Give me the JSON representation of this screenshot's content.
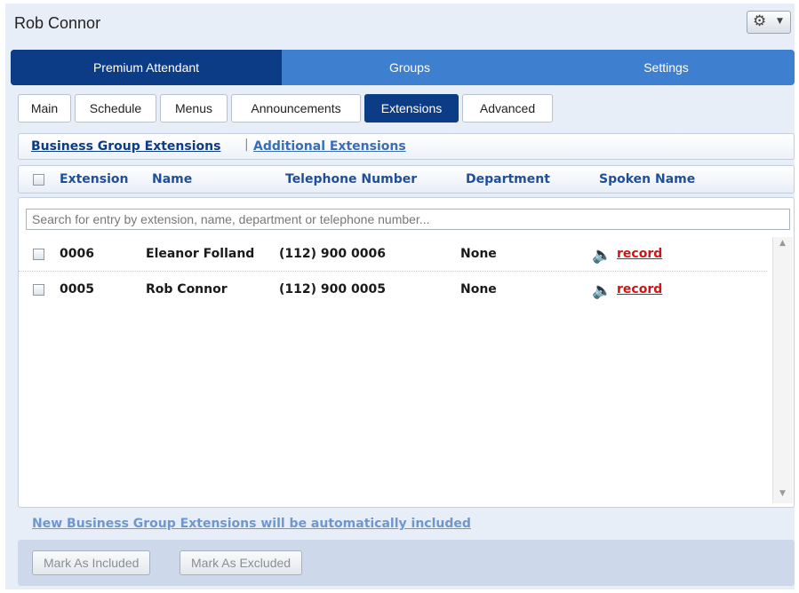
{
  "window": {
    "title": "Rob Connor",
    "gear_icon": "gear-icon",
    "caret_icon": "chevron-down-icon"
  },
  "main_tabs": [
    {
      "label": "Premium Attendant",
      "active": true
    },
    {
      "label": "Groups",
      "active": false
    },
    {
      "label": "Settings",
      "active": false
    }
  ],
  "sub_tabs": [
    {
      "label": "Main"
    },
    {
      "label": "Schedule"
    },
    {
      "label": "Menus"
    },
    {
      "label": "Announcements"
    },
    {
      "label": "Extensions",
      "active": true
    },
    {
      "label": "Advanced"
    }
  ],
  "ext_links": {
    "business": "Business Group Extensions",
    "separator": "|",
    "additional": "Additional Extensions"
  },
  "table": {
    "columns": [
      "Extension",
      "Name",
      "Telephone Number",
      "Department",
      "Spoken Name"
    ],
    "search_placeholder": "Search for entry by extension, name, department or telephone number...",
    "rows": [
      {
        "extension": "0006",
        "name": "Eleanor Folland",
        "phone": "(112) 900 0006",
        "department": "None",
        "spoken": "record"
      },
      {
        "extension": "0005",
        "name": "Rob Connor",
        "phone": "(112) 900 0005",
        "department": "None",
        "spoken": "record"
      }
    ]
  },
  "footer": {
    "note": "New Business Group Extensions will be automatically included",
    "mark_included": "Mark As Included",
    "mark_excluded": "Mark As Excluded"
  },
  "colors": {
    "accent": "#0d3c86",
    "tab_bar": "#3f7fd0",
    "record_link": "#d31212"
  }
}
